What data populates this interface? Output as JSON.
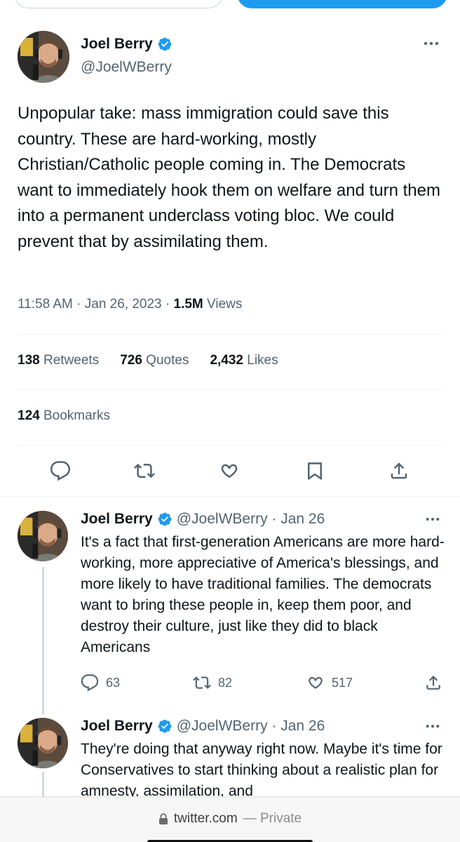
{
  "main_tweet": {
    "author_name": "Joel Berry",
    "handle": "@JoelWBerry",
    "text": "Unpopular take: mass immigration could save this country. These are hard-working, mostly Christian/Catholic people coming in. The Democrats want to immediately hook them on welfare and turn them into a permanent underclass voting bloc. We could prevent that by assimilating them.",
    "timestamp": "11:58 AM · Jan 26, 2023 · ",
    "views_count": "1.5M",
    "views_label": " Views",
    "retweets_count": "138",
    "retweets_label": " Retweets",
    "quotes_count": "726",
    "quotes_label": " Quotes",
    "likes_count": "2,432",
    "likes_label": " Likes",
    "bookmarks_count": "124",
    "bookmarks_label": " Bookmarks"
  },
  "replies": [
    {
      "author_name": "Joel Berry",
      "handle_date": "@JoelWBerry · Jan 26",
      "text": "It's a fact that first-generation Americans are more hard-working, more appreciative of America's blessings, and more likely to have traditional families. The democrats want to bring these people in, keep them poor, and destroy their culture, just like they did to black Americans",
      "replies_count": "63",
      "retweets_count": "82",
      "likes_count": "517"
    },
    {
      "author_name": "Joel Berry",
      "handle_date": "@JoelWBerry · Jan 26",
      "text": "They're doing that anyway right now. Maybe it's time for Conservatives to start thinking about a realistic plan for amnesty, assimilation, and"
    }
  ],
  "browser": {
    "domain": "twitter.com",
    "privacy": "— Private"
  },
  "colors": {
    "accent": "#1d9bf0",
    "secondary_text": "#536471",
    "primary_text": "#0f1419"
  }
}
